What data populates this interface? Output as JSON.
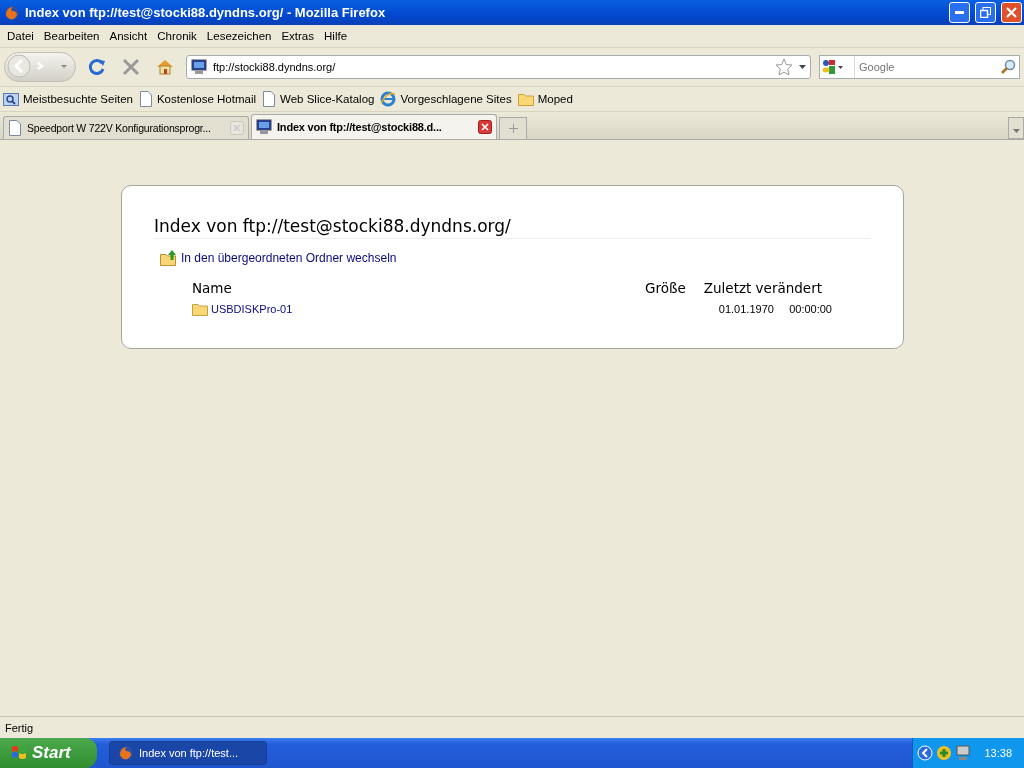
{
  "window": {
    "title": "Index von ftp://test@stocki88.dyndns.org/ - Mozilla Firefox"
  },
  "menu": [
    "Datei",
    "Bearbeiten",
    "Ansicht",
    "Chronik",
    "Lesezeichen",
    "Extras",
    "Hilfe"
  ],
  "address_bar": {
    "value": "ftp://stocki88.dyndns.org/"
  },
  "search": {
    "placeholder": "Google"
  },
  "bookmarks": [
    {
      "kind": "smart",
      "label": "Meistbesuchte Seiten"
    },
    {
      "kind": "page",
      "label": "Kostenlose Hotmail"
    },
    {
      "kind": "page",
      "label": "Web Slice-Katalog"
    },
    {
      "kind": "ie",
      "label": "Vorgeschlagene Sites"
    },
    {
      "kind": "folder",
      "label": "Moped"
    }
  ],
  "tabs": [
    {
      "label": "Speedport W 722V Konfigurationsprogr...",
      "selected": false
    },
    {
      "label": "Index von ftp://test@stocki88.d...",
      "selected": true
    }
  ],
  "listing": {
    "heading": "Index von ftp://test@stocki88.dyndns.org/",
    "parent_link": "In den übergeordneten Ordner wechseln",
    "columns": [
      "Name",
      "Größe",
      "Zuletzt verändert"
    ],
    "rows": [
      {
        "name": "USBDISKPro-01",
        "date": "01.01.1970",
        "time": "00:00:00"
      }
    ]
  },
  "status_bar": "Fertig",
  "taskbar": {
    "start": "Start",
    "tasks": [
      {
        "label": "Index von ftp://test...",
        "selected": true
      }
    ],
    "clock": "13:38"
  }
}
